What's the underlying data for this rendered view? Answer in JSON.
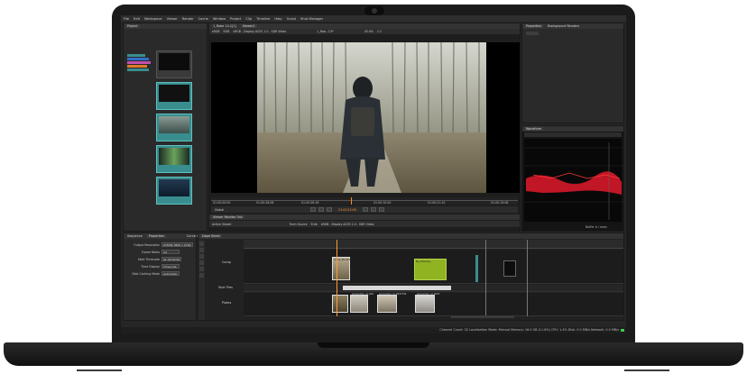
{
  "menu": [
    "File",
    "Edit",
    "Workspace",
    "Viewer",
    "Render",
    "Cache",
    "Window",
    "Project",
    "Clip",
    "Timeline",
    "Help",
    "Script",
    "Shot Manager"
  ],
  "panels": {
    "project_tab": "Project",
    "viewer_tabs": [
      "1_Robe 14.1[1]",
      "Viewer1"
    ],
    "properties_tabs": [
      "Properties",
      "Background Renders"
    ],
    "waveform_tab": "Waveform",
    "waveform_caption": "Buffer A / main",
    "bottom_tabs": [
      "Sequence",
      "Properties"
    ],
    "curve_tab": "Curve Editor",
    "dope_tab": "Dope Sheet",
    "viewer_monitor_tab": "Viewer Monitor Out"
  },
  "viewer": {
    "toolbar": [
      "sRGB",
      "RGB",
      "sRGB - Display ACES 1.0 - SDR Video",
      "1_Rob...C3*",
      "45.0%",
      "1:1"
    ],
    "timecodes": [
      "01:00:00:00",
      "01:00:28:08",
      "01:00:06:16",
      "01:00:10:00",
      "01:00:21:10",
      "01:00:19:08"
    ],
    "current_tc": "01:00:22:06",
    "global_label": "Global",
    "toolbar2": [
      "Active Viewer",
      "From Source",
      "8 bit",
      "sRGB - Display ACES 1.0 - SDR Video"
    ]
  },
  "sequence_props": [
    {
      "key": "Output Resolution",
      "value": "UHD4K 3840 x 2160"
    },
    {
      "key": "Frame Rates",
      "value": "24"
    },
    {
      "key": "Start Timecode",
      "value": "01:00:00:00"
    },
    {
      "key": "Time Display",
      "value": "Timecode"
    },
    {
      "key": "Disk Caching Mode",
      "value": "Automatic"
    }
  ],
  "dope_tracks": [
    {
      "label": "Comp"
    },
    {
      "label": "Shot Pres"
    },
    {
      "label": "Plates"
    }
  ],
  "dope_clip_labels": [
    "Comp_Bucket",
    "My_Tracking",
    "production_id_499",
    "production_id_4097704",
    "production_id_4097"
  ],
  "status_text": "Channel Count: 32 Localization Mode: Manual Memory: 16.0 GB (11.8%) CPU: 1.4% Disk: 0.0 MB/s Network: 0.0 MB/s",
  "colors": {
    "accent": "#ff8a2a",
    "clip_teal": "#3a8d8e",
    "wave_red": "#e0192a",
    "green_clip": "#8fb321"
  }
}
